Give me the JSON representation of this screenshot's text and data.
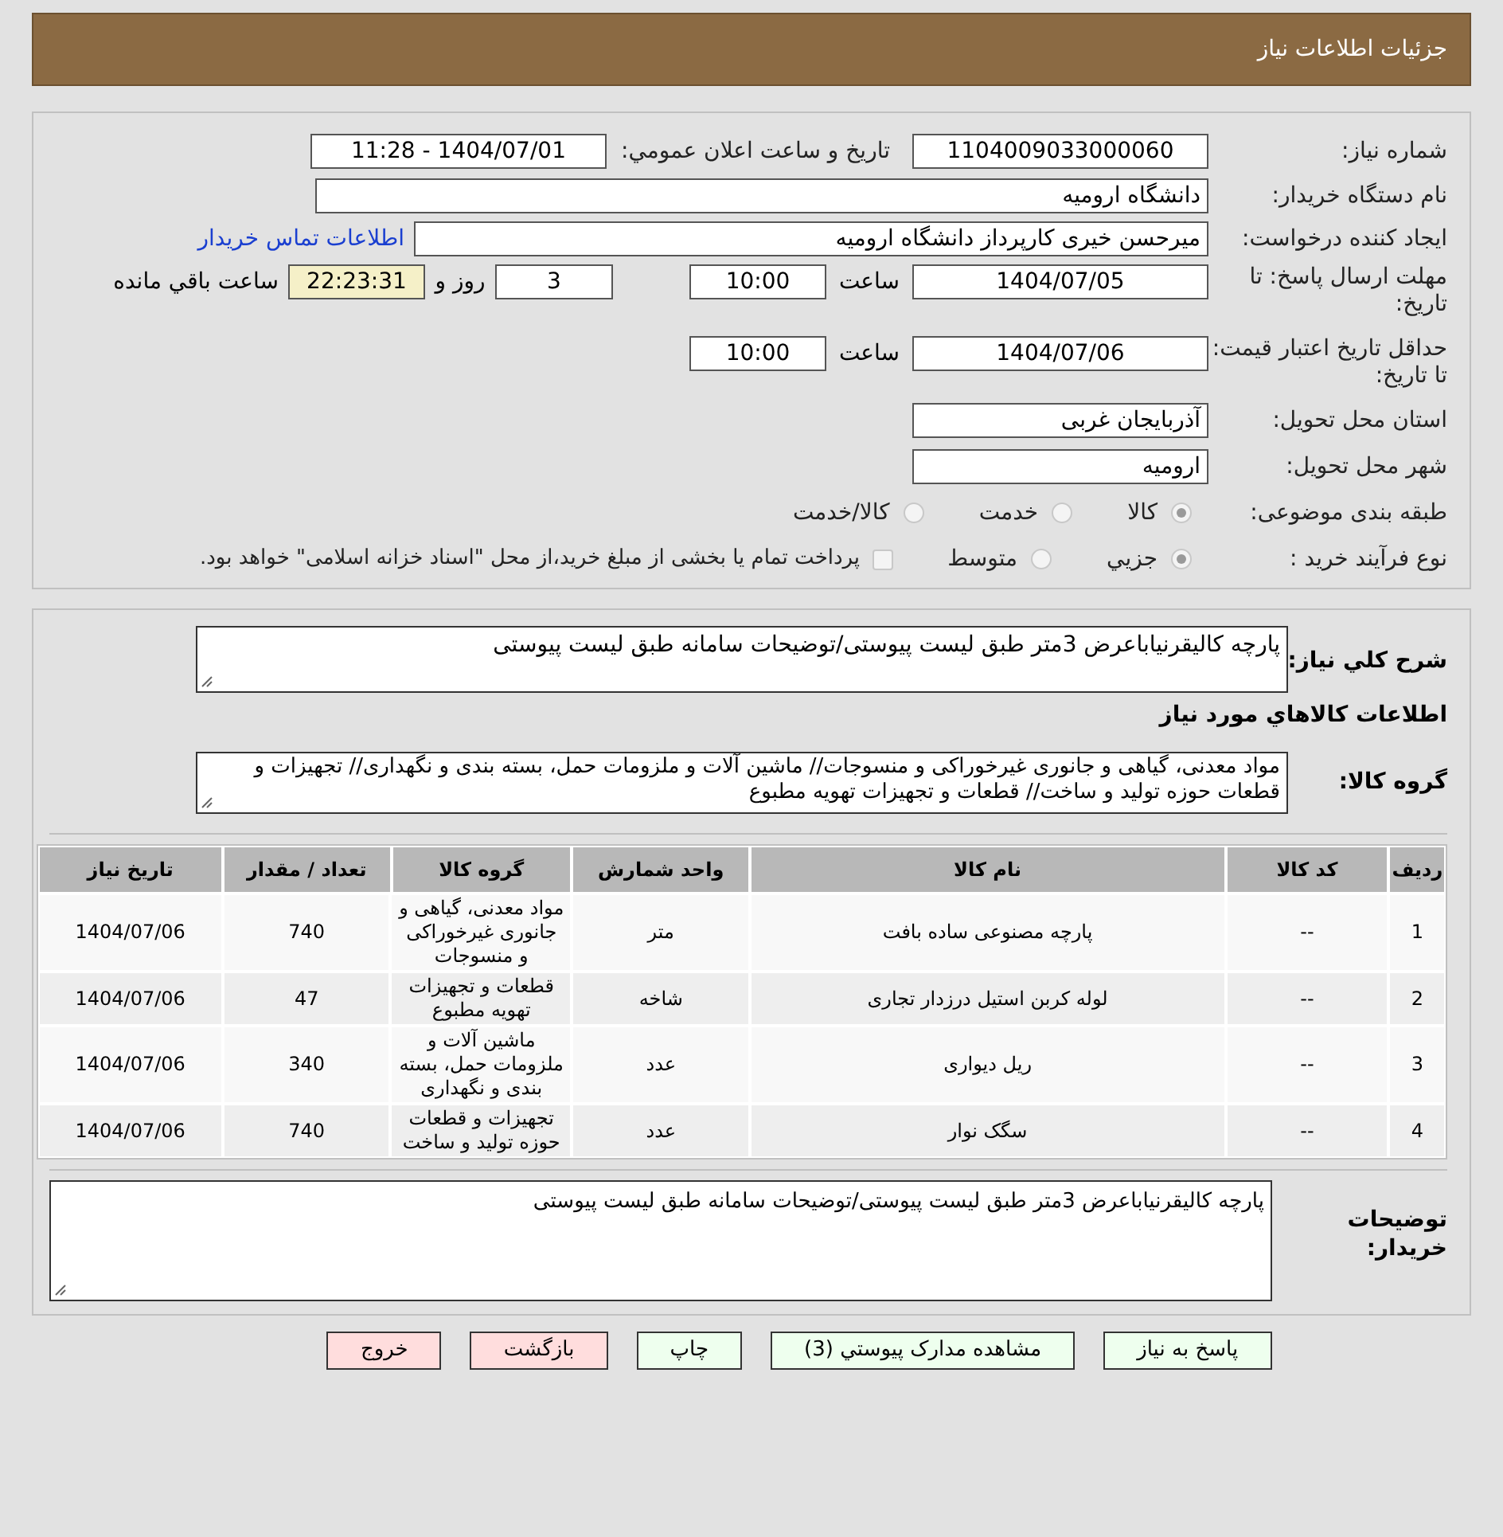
{
  "header": {
    "title": "جزئیات اطلاعات نیاز"
  },
  "need_number": {
    "label": "شماره نیاز:",
    "value": "1104009033000060"
  },
  "announce": {
    "label": "تاریخ و ساعت اعلان عمومي:",
    "value": "1404/07/01 - 11:28"
  },
  "buyer_org": {
    "label": "نام دستگاه خریدار:",
    "value": "دانشگاه ارومیه"
  },
  "requester": {
    "label": "ایجاد کننده درخواست:",
    "value": "میرحسن خیری کارپرداز دانشگاه ارومیه",
    "link": "اطلاعات تماس خریدار"
  },
  "reply_deadline": {
    "label": "مهلت ارسال پاسخ: تا تاریخ:",
    "date": "1404/07/05",
    "time_label": "ساعت",
    "time": "10:00",
    "days": "3",
    "days_label": "روز و",
    "remaining": "22:23:31",
    "remaining_label": "ساعت باقي مانده"
  },
  "price_validity": {
    "label": "حداقل تاریخ اعتبار قیمت: تا تاریخ:",
    "date": "1404/07/06",
    "time_label": "ساعت",
    "time": "10:00"
  },
  "province": {
    "label": "استان محل تحویل:",
    "value": "آذربایجان غربی"
  },
  "city": {
    "label": "شهر محل تحویل:",
    "value": "ارومیه"
  },
  "category": {
    "label": "طبقه بندی موضوعی:",
    "options": [
      {
        "label": "کالا",
        "selected": true
      },
      {
        "label": "خدمت",
        "selected": false
      },
      {
        "label": "کالا/خدمت",
        "selected": false
      }
    ]
  },
  "process": {
    "label": "نوع فرآیند خرید :",
    "options": [
      {
        "label": "جزيي",
        "selected": true
      },
      {
        "label": "متوسط",
        "selected": false
      }
    ],
    "payment": {
      "label": "پرداخت تمام یا بخشی از مبلغ خرید،از محل \"اسناد خزانه اسلامی\" خواهد بود.",
      "checked": false
    }
  },
  "description": {
    "label": "شرح کلي نیاز:",
    "value": "پارچه کالیقرنیاباعرض 3متر طبق لیست پیوستی/توضیحات سامانه طبق لیست پیوستی"
  },
  "goods_heading": "اطلاعات کالاهاي مورد نیاز",
  "goods_group": {
    "label": "گروه کالا:",
    "value": "مواد معدنی، گیاهی و جانوری غیرخوراکی و منسوجات// ماشین آلات و ملزومات حمل، بسته بندی و نگهداری// تجهیزات و قطعات حوزه تولید و ساخت//  قطعات و تجهیزات تهویه مطبوع"
  },
  "table": {
    "columns": [
      "ردیف",
      "کد کالا",
      "نام کالا",
      "واحد شمارش",
      "گروه کالا",
      "تعداد / مقدار",
      "تاریخ نیاز"
    ],
    "rows": [
      {
        "cells": [
          "1",
          "--",
          "پارچه مصنوعی ساده بافت",
          "متر",
          "مواد معدنی، گیاهی و جانوری غیرخوراکی و منسوجات",
          "740",
          "1404/07/06"
        ]
      },
      {
        "cells": [
          "2",
          "--",
          "لوله کربن استیل درزدار تجاری",
          "شاخه",
          "قطعات و تجهیزات تهویه مطبوع",
          "47",
          "1404/07/06"
        ]
      },
      {
        "cells": [
          "3",
          "--",
          "ریل دیواری",
          "عدد",
          "ماشین آلات و ملزومات حمل، بسته بندی و نگهداری",
          "340",
          "1404/07/06"
        ]
      },
      {
        "cells": [
          "4",
          "--",
          "سگک نوار",
          "عدد",
          "تجهیزات و قطعات حوزه تولید و ساخت",
          "740",
          "1404/07/06"
        ]
      }
    ]
  },
  "buyer_notes": {
    "label": "توضیحات خریدار:",
    "value": "پارچه کالیقرنیاباعرض 3متر طبق لیست پیوستی/توضیحات سامانه طبق لیست پیوستی"
  },
  "buttons": [
    {
      "label": "پاسخ به نیاز",
      "kind": "action"
    },
    {
      "label": "مشاهده مدارک پیوستي (3)",
      "kind": "action"
    },
    {
      "label": "چاپ",
      "kind": "action"
    },
    {
      "label": "بازگشت",
      "kind": "exit"
    },
    {
      "label": "خروج",
      "kind": "exit"
    }
  ]
}
